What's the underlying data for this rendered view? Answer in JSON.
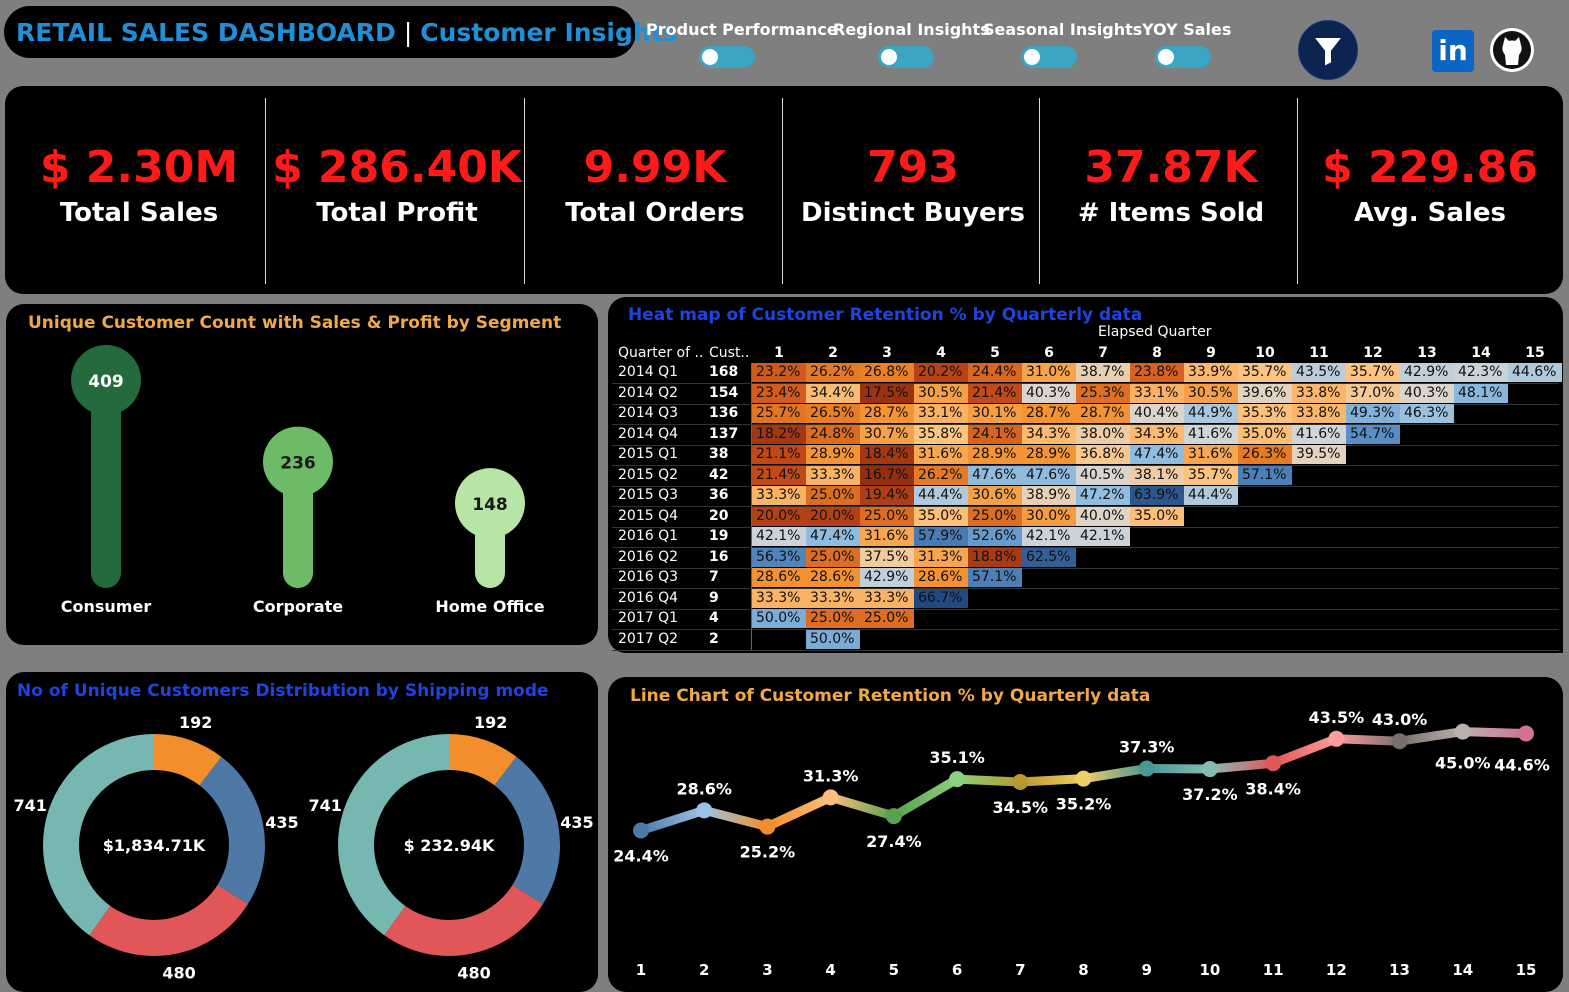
{
  "header": {
    "title_main": "RETAIL SALES DASHBOARD",
    "title_separator": "|",
    "title_sub": "Customer Insights",
    "nav": [
      {
        "label": "Product Performance"
      },
      {
        "label": "Regional Insights"
      },
      {
        "label": "Seasonal Insights"
      },
      {
        "label": "YOY Sales"
      }
    ],
    "icons": {
      "filter": "filter-funnel-icon",
      "linkedin": "linkedin-icon",
      "github": "github-icon"
    },
    "linkedin_text": "in"
  },
  "kpis": [
    {
      "value": "$ 2.30M",
      "label": "Total Sales"
    },
    {
      "value": "$ 286.40K",
      "label": "Total Profit"
    },
    {
      "value": "9.99K",
      "label": "Total Orders"
    },
    {
      "value": "793",
      "label": "Distinct Buyers"
    },
    {
      "value": "37.87K",
      "label": "# Items Sold"
    },
    {
      "value": "$ 229.86",
      "label": "Avg. Sales"
    }
  ],
  "colors": {
    "kpi_value": "#ff1a1a",
    "title_blue": "#1f8fd6",
    "panel_title_orange": "#f0a848",
    "panel_title_blue": "#1e44e0"
  },
  "segment_panel": {
    "title": "Unique Customer Count with Sales & Profit by Segment",
    "segments": [
      {
        "name": "Consumer",
        "count": 409,
        "label": "409",
        "color": "#236b3c"
      },
      {
        "name": "Corporate",
        "count": 236,
        "label": "236",
        "color": "#6dbb67"
      },
      {
        "name": "Home Office",
        "count": 148,
        "label": "148",
        "color": "#b7e5a6"
      }
    ]
  },
  "heatmap": {
    "title": "Heat map of Customer Retention % by Quarterly data",
    "top_header": "Elapsed Quarter",
    "row_header": "Quarter of ..",
    "count_header": "Cust..",
    "columns": [
      "1",
      "2",
      "3",
      "4",
      "5",
      "6",
      "7",
      "8",
      "9",
      "10",
      "11",
      "12",
      "13",
      "14",
      "15"
    ],
    "rows": [
      {
        "q": "2014 Q1",
        "c": "168",
        "v": [
          23.2,
          26.2,
          26.8,
          20.2,
          24.4,
          31.0,
          38.7,
          23.8,
          33.9,
          35.7,
          43.5,
          35.7,
          42.9,
          42.3,
          44.6
        ]
      },
      {
        "q": "2014 Q2",
        "c": "154",
        "v": [
          23.4,
          34.4,
          17.5,
          30.5,
          21.4,
          40.3,
          25.3,
          33.1,
          30.5,
          39.6,
          33.8,
          37.0,
          40.3,
          48.1
        ]
      },
      {
        "q": "2014 Q3",
        "c": "136",
        "v": [
          25.7,
          26.5,
          28.7,
          33.1,
          30.1,
          28.7,
          28.7,
          40.4,
          44.9,
          35.3,
          33.8,
          49.3,
          46.3
        ]
      },
      {
        "q": "2014 Q4",
        "c": "137",
        "v": [
          18.2,
          24.8,
          30.7,
          35.8,
          24.1,
          34.3,
          38.0,
          34.3,
          41.6,
          35.0,
          41.6,
          54.7
        ]
      },
      {
        "q": "2015 Q1",
        "c": "38",
        "v": [
          21.1,
          28.9,
          18.4,
          31.6,
          28.9,
          28.9,
          36.8,
          47.4,
          31.6,
          26.3,
          39.5
        ]
      },
      {
        "q": "2015 Q2",
        "c": "42",
        "v": [
          21.4,
          33.3,
          16.7,
          26.2,
          47.6,
          47.6,
          40.5,
          38.1,
          35.7,
          57.1
        ]
      },
      {
        "q": "2015 Q3",
        "c": "36",
        "v": [
          33.3,
          25.0,
          19.4,
          44.4,
          30.6,
          38.9,
          47.2,
          63.9,
          44.4
        ]
      },
      {
        "q": "2015 Q4",
        "c": "20",
        "v": [
          20.0,
          20.0,
          25.0,
          35.0,
          25.0,
          30.0,
          40.0,
          35.0
        ]
      },
      {
        "q": "2016 Q1",
        "c": "19",
        "v": [
          42.1,
          47.4,
          31.6,
          57.9,
          52.6,
          42.1,
          42.1
        ]
      },
      {
        "q": "2016 Q2",
        "c": "16",
        "v": [
          56.3,
          25.0,
          37.5,
          31.3,
          18.8,
          62.5
        ]
      },
      {
        "q": "2016 Q3",
        "c": "7",
        "v": [
          28.6,
          28.6,
          42.9,
          28.6,
          57.1
        ]
      },
      {
        "q": "2016 Q4",
        "c": "9",
        "v": [
          33.3,
          33.3,
          33.3,
          66.7
        ]
      },
      {
        "q": "2017 Q1",
        "c": "4",
        "v": [
          50.0,
          25.0,
          25.0
        ]
      },
      {
        "q": "2017 Q2",
        "c": "2",
        "v": [
          null,
          50.0
        ]
      }
    ]
  },
  "shipping_panel": {
    "title": "No of Unique Customers Distribution by Shipping mode",
    "donuts": [
      {
        "center": "$1,834.71K",
        "slices": [
          {
            "value": 192,
            "label": "192",
            "color": "#f28e2b"
          },
          {
            "value": 435,
            "label": "435",
            "color": "#4e79a7"
          },
          {
            "value": 480,
            "label": "480",
            "color": "#e15759"
          },
          {
            "value": 741,
            "label": "741",
            "color": "#76b7b2"
          }
        ]
      },
      {
        "center": "$ 232.94K",
        "slices": [
          {
            "value": 192,
            "label": "192",
            "color": "#f28e2b"
          },
          {
            "value": 435,
            "label": "435",
            "color": "#4e79a7"
          },
          {
            "value": 480,
            "label": "480",
            "color": "#e15759"
          },
          {
            "value": 741,
            "label": "741",
            "color": "#76b7b2"
          }
        ]
      }
    ]
  },
  "chart_data": {
    "type": "line",
    "title": "Line Chart  of Customer Retention % by Quarterly data",
    "x": [
      "1",
      "2",
      "3",
      "4",
      "5",
      "6",
      "7",
      "8",
      "9",
      "10",
      "11",
      "12",
      "13",
      "14",
      "15"
    ],
    "series": [
      {
        "values": [
          24.4,
          28.6,
          25.2,
          31.3,
          27.4,
          35.1,
          34.5,
          35.2,
          37.3,
          37.2,
          38.4,
          43.5,
          43.0,
          45.0,
          44.6
        ]
      }
    ],
    "labels": [
      "24.4%",
      "28.6%",
      "25.2%",
      "31.3%",
      "27.4%",
      "35.1%",
      "34.5%",
      "35.2%",
      "37.3%",
      "37.2%",
      "38.4%",
      "43.5%",
      "43.0%",
      "45.0%",
      "44.6%"
    ],
    "point_colors": [
      "#4e79a7",
      "#9cc3e4",
      "#f28e2b",
      "#ffbe7d",
      "#59a14f",
      "#8cd17d",
      "#b6992d",
      "#f1ce63",
      "#499894",
      "#86bcb6",
      "#e15759",
      "#ff9d9a",
      "#79706e",
      "#bab0ac",
      "#d37295"
    ],
    "ylim": [
      22,
      47
    ],
    "grid": false
  }
}
